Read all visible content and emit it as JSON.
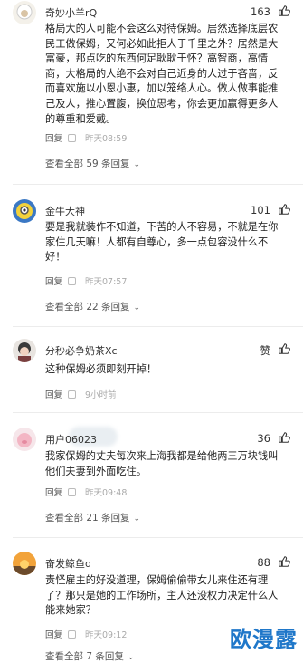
{
  "comments": [
    {
      "username": "奇妙小羊rQ",
      "likes": "163",
      "text": "格局大的人可能不会这么对待保姆。居然选择底层农民工做保姆，又何必如此拒人于千里之外？居然是大富豪，那点吃的东西何足耿耿于怀？高智商，高情商，大格局的人绝不会对自己近身的人过于吝啬，反而喜欢施以小恩小惠，加以笼络人心。做人做事能推己及人，推心置腹，换位思考，你会更加赢得更多人的尊重和爱戴。",
      "reply_label": "回复",
      "time": "昨天08:59",
      "view_all": "查看全部 59 条回复"
    },
    {
      "username": "金牛大神",
      "likes": "101",
      "text": "要是我就装作不知道，下苦的人不容易，不就是在你家住几天嘛！人都有自尊心，多一点包容没什么不好！",
      "reply_label": "回复",
      "time": "昨天07:57",
      "view_all": "查看全部 22 条回复"
    },
    {
      "username": "分秒必争奶茶Xc",
      "likes": "赞",
      "text": "这种保姆必须即刻开掉！",
      "reply_label": "回复",
      "time": "9小时前",
      "view_all": ""
    },
    {
      "username": "用户06023",
      "likes": "36",
      "text": "我家保姆的丈夫每次来上海我都是给他两三万块钱叫他们夫妻到外面吃住。",
      "reply_label": "回复",
      "time": "昨天09:48",
      "view_all": "查看全部 21 条回复"
    },
    {
      "username": "奋发鲸鱼d",
      "likes": "88",
      "text": "责怪雇主的好没道理，保姆偷偷带女儿来住还有理了？那只是她的工作场所，主人还没权力决定什么人能来她家？",
      "reply_label": "回复",
      "time": "昨天09:12",
      "view_all": "查看全部 7 条回复"
    }
  ],
  "watermark": "欧漫露",
  "colors": {
    "watermark": "#1f77c9",
    "meta": "#777777",
    "accent_like": "#333333"
  },
  "icons": {
    "like": "thumbs-up-icon",
    "chevron": "chevron-down-icon"
  }
}
